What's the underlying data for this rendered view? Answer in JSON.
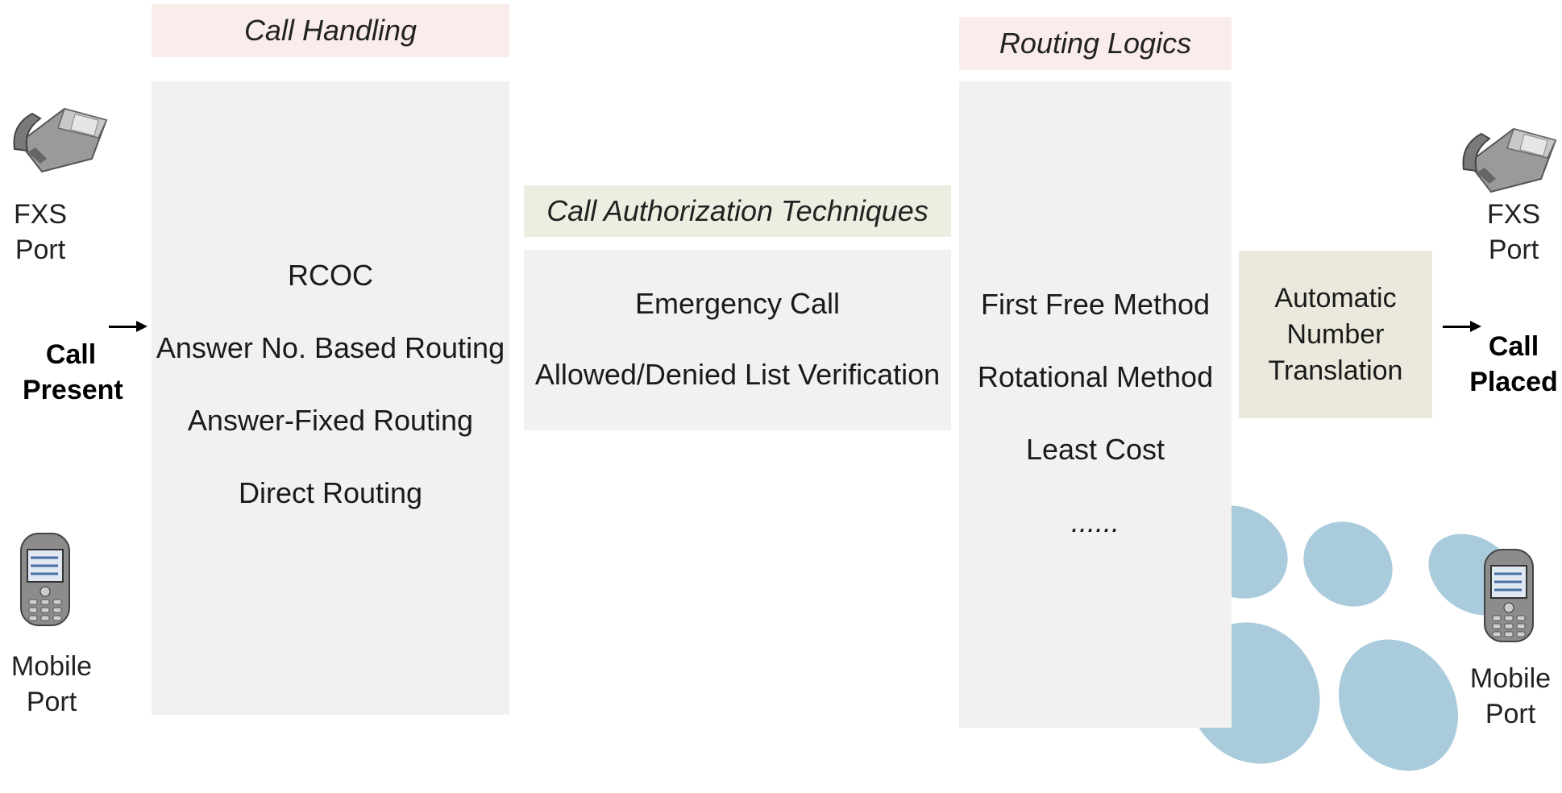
{
  "call_handling": {
    "title": "Call Handling",
    "items": [
      "RCOC",
      "Answer No. Based Routing",
      "Answer-Fixed Routing",
      "Direct Routing"
    ]
  },
  "call_authorization": {
    "title": "Call Authorization Techniques",
    "items": [
      "Emergency Call",
      "Allowed/Denied List Verification"
    ]
  },
  "routing_logics": {
    "title": "Routing Logics",
    "items": [
      "First Free Method",
      "Rotational Method",
      "Least Cost",
      "......"
    ]
  },
  "number_translation": {
    "lines": [
      "Automatic",
      "Number",
      "Translation"
    ]
  },
  "left_ports": {
    "fxs": [
      "FXS",
      "Port"
    ],
    "mobile": [
      "Mobile",
      "Port"
    ],
    "call": [
      "Call",
      "Present"
    ]
  },
  "right_ports": {
    "fxs": [
      "FXS",
      "Port"
    ],
    "mobile": [
      "Mobile",
      "Port"
    ],
    "call": [
      "Call",
      "Placed"
    ]
  },
  "colors": {
    "header_pink": "#fbecec",
    "header_beige": "#eeede2",
    "panel_gray": "#f1f1f1",
    "translation_box": "#ebe9dd",
    "blob_blue": "#a9cbdb"
  },
  "icons": {
    "desk_phone": "desk-phone-icon",
    "mobile_phone": "mobile-phone-icon"
  }
}
